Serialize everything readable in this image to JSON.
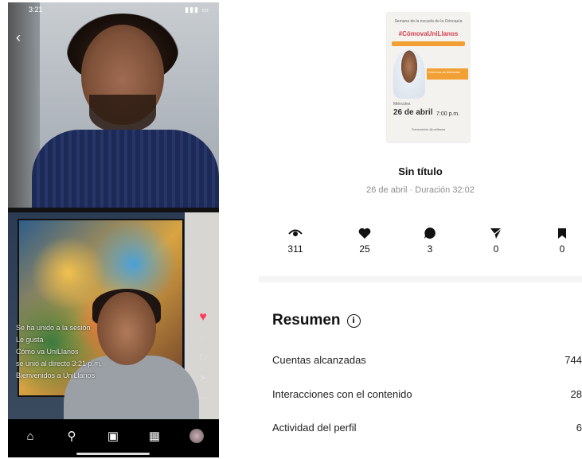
{
  "video": {
    "status_time": "3:21",
    "back_icon": "chevron-left-icon",
    "comments": [
      "Se ha unido a la sesión",
      "Le gusta",
      "Cómo va UniLlanos",
      "se unió al directo 3:21 p.m.",
      "Bienvenidos a UniLlanos"
    ],
    "nav_icons": [
      "home-icon",
      "search-icon",
      "reels-icon",
      "activity-icon",
      "profile-avatar"
    ]
  },
  "post": {
    "thumbnail": {
      "subtitle": "Semana de la escuela de la Orinoquía",
      "hashtag": "#CómovaUniLlanos",
      "tag": "Directora de Bienestar",
      "day": "Miércoles",
      "date": "26 de abril",
      "time": "7:00 p.m.",
      "footer": "Transmisión @unillanos"
    },
    "title": "Sin título",
    "meta": "26 de abril · Duración 32:02"
  },
  "stats": [
    {
      "icon": "eye-icon",
      "value": "311"
    },
    {
      "icon": "heart-icon",
      "value": "25"
    },
    {
      "icon": "comment-icon",
      "value": "3"
    },
    {
      "icon": "share-icon",
      "value": "0"
    },
    {
      "icon": "bookmark-icon",
      "value": "0"
    }
  ],
  "summary": {
    "title": "Resumen",
    "rows": [
      {
        "label": "Cuentas alcanzadas",
        "value": "744"
      },
      {
        "label": "Interacciones con el contenido",
        "value": "28"
      },
      {
        "label": "Actividad del perfil",
        "value": "6"
      }
    ]
  }
}
